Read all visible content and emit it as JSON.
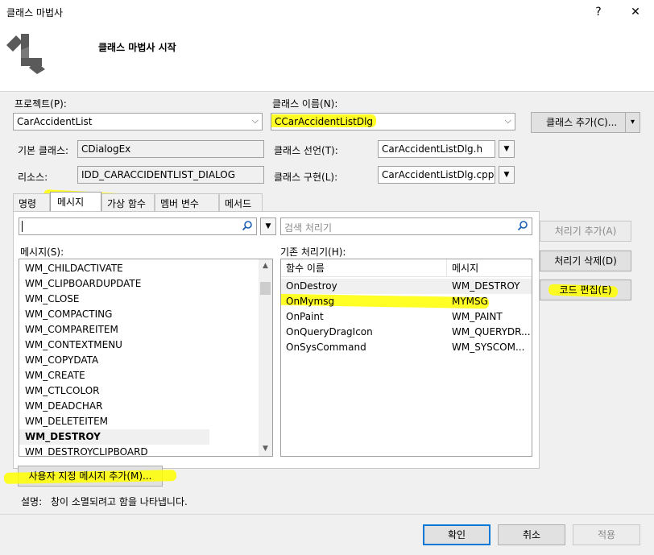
{
  "window": {
    "title": "클래스 마법사",
    "help_glyph": "?",
    "close_glyph": "✕"
  },
  "header": {
    "title": "클래스 마법사 시작"
  },
  "project": {
    "label": "프로젝트(P):",
    "value": "CarAccidentList"
  },
  "class_name": {
    "label": "클래스 이름(N):",
    "value": "CCarAccidentListDlg"
  },
  "add_class_button": {
    "label": "클래스 추가(C)...",
    "arrow": "▾"
  },
  "base_class": {
    "label": "기본 클래스:",
    "value": "CDialogEx"
  },
  "class_decl": {
    "label": "클래스 선언(T):",
    "value": "CarAccidentListDlg.h"
  },
  "resource": {
    "label": "리소스:",
    "value": "IDD_CARACCIDENTLIST_DIALOG"
  },
  "class_impl": {
    "label": "클래스 구현(L):",
    "value": "CarAccidentListDlg.cpp"
  },
  "tabs": [
    "명령",
    "메시지",
    "가상 함수",
    "멤버 변수",
    "메서드"
  ],
  "messages": {
    "search_value": "",
    "list_label": "메시지(S):",
    "items": [
      "WM_CHILDACTIVATE",
      "WM_CLIPBOARDUPDATE",
      "WM_CLOSE",
      "WM_COMPACTING",
      "WM_COMPAREITEM",
      "WM_CONTEXTMENU",
      "WM_COPYDATA",
      "WM_CREATE",
      "WM_CTLCOLOR",
      "WM_DEADCHAR",
      "WM_DELETEITEM",
      "WM_DESTROY",
      "WM_DESTROYCLIPBOARD"
    ],
    "selected": "WM_DESTROY"
  },
  "handlers": {
    "search_placeholder": "검색 처리기",
    "list_label": "기존 처리기(H):",
    "columns": [
      "함수 이름",
      "메시지"
    ],
    "rows": [
      {
        "func": "OnDestroy",
        "msg": "WM_DESTROY"
      },
      {
        "func": "OnMymsg",
        "msg": "MYMSG"
      },
      {
        "func": "OnPaint",
        "msg": "WM_PAINT"
      },
      {
        "func": "OnQueryDragIcon",
        "msg": "WM_QUERYDR..."
      },
      {
        "func": "OnSysCommand",
        "msg": "WM_SYSCOM..."
      }
    ]
  },
  "side_buttons": {
    "add_handler": "처리기 추가(A)",
    "delete_handler": "처리기 삭제(D)",
    "edit_code": "코드 편집(E)"
  },
  "custom_message_button": "사용자 지정 메시지 추가(M)...",
  "description": {
    "label": "설명:",
    "text": "창이 소멸되려고 함을 나타냅니다."
  },
  "footer": {
    "ok": "확인",
    "cancel": "취소",
    "apply": "적용"
  },
  "colors": {
    "highlight": "#ffff00",
    "accent": "#0078d7"
  },
  "icons": {
    "app": "class-wizard-icon",
    "search": "search-icon",
    "dropdown": "chevron-down-icon"
  }
}
